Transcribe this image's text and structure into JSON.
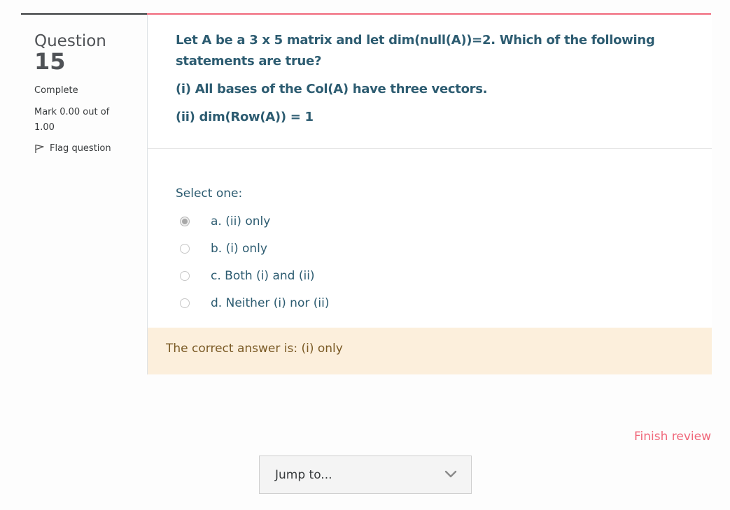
{
  "question_info": {
    "label": "Question",
    "number": "15",
    "state": "Complete",
    "grade": "Mark 0.00 out of 1.00",
    "flag_label": "Flag question"
  },
  "question": {
    "text_line1": "Let A be a 3 x 5 matrix and let dim(null(A))=2. Which of the following statements are true?",
    "statement_1": "(i) All bases of the Col(A) have three vectors.",
    "statement_2": "(ii) dim(Row(A)) = 1"
  },
  "answer_block": {
    "prompt": "Select one:",
    "options": [
      {
        "label": "a. (ii) only",
        "selected": true
      },
      {
        "label": "b. (i) only",
        "selected": false
      },
      {
        "label": "c. Both (i) and (ii)",
        "selected": false
      },
      {
        "label": "d. Neither (i) nor (ii)",
        "selected": false
      }
    ]
  },
  "feedback": {
    "right_answer": "The correct answer is: (i) only"
  },
  "navigation": {
    "finish_review": "Finish review",
    "jump_to": "Jump to..."
  },
  "colors": {
    "accent": "#f0677a",
    "question_text": "#2d5c71",
    "feedback_bg": "#fcefdc",
    "feedback_text": "#7a5a25"
  },
  "icons": {
    "flag": "flag-icon",
    "dropdown": "chevron-down-icon",
    "radio": "radio-icon"
  }
}
